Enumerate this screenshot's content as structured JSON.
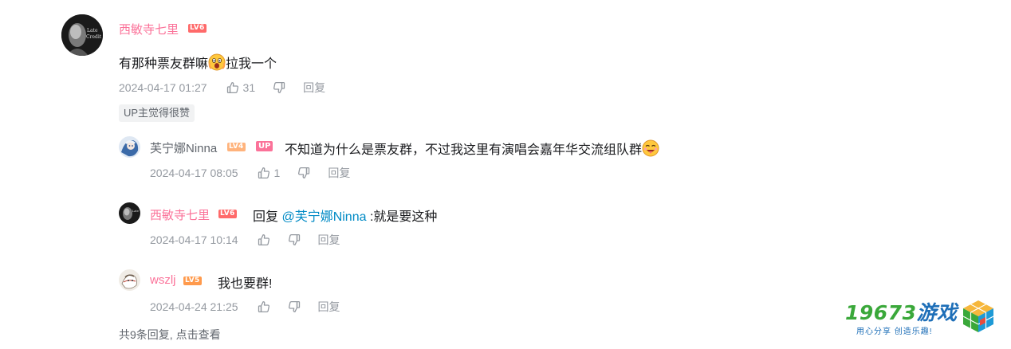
{
  "colors": {
    "username_pink": "#fb7299",
    "username_dark": "#61666d",
    "lv6": "#ff6a6a",
    "lv4": "#ffb37c",
    "lv5": "#ff9a4c",
    "up_badge": "#fb7299",
    "link": "#008ac5",
    "meta_gray": "#9499a0"
  },
  "main_comment": {
    "username": "西敏寺七里",
    "level": "LV6",
    "content": "有那种票友群嘛",
    "content_after_emoji": "拉我一个",
    "time": "2024-04-17 01:27",
    "likes": "31",
    "reply_label": "回复",
    "up_tag": "UP主觉得很赞"
  },
  "replies": [
    {
      "username": "芙宁娜Ninna",
      "level": "LV4",
      "badge": "UP",
      "content": "不知道为什么是票友群，不过我这里有演唱会嘉年华交流组队群",
      "time": "2024-04-17 08:05",
      "likes": "1",
      "reply_label": "回复"
    },
    {
      "username": "西敏寺七里",
      "level": "LV6",
      "reply_prefix": "回复 ",
      "mention": "@芙宁娜Ninna",
      "content": " :就是要这种",
      "time": "2024-04-17 10:14",
      "reply_label": "回复"
    },
    {
      "username": "wszlj",
      "level": "LV5",
      "content": "我也要群!",
      "time": "2024-04-24 21:25",
      "reply_label": "回复"
    }
  ],
  "footer": {
    "text": "共9条回复, 点击查看"
  },
  "watermark": {
    "title_num": "19673",
    "title_cn": "游戏",
    "subtitle": "用心分享  创造乐趣!"
  }
}
